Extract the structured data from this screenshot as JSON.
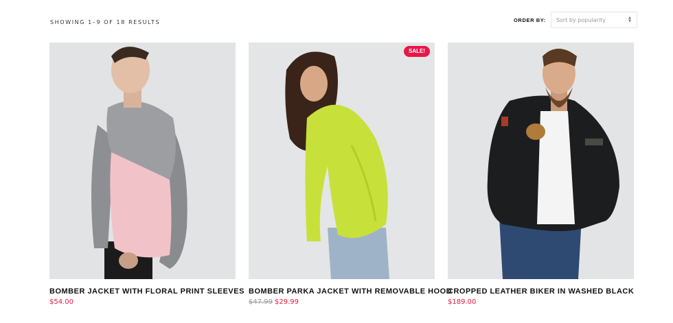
{
  "shop": {
    "result_count": "SHOWING 1–9 OF 18 RESULTS",
    "ordering": {
      "label": "ORDER BY:",
      "selected": "Sort by popularity"
    },
    "colors": {
      "accent": "#e5193c",
      "badge": "#e8174a"
    }
  },
  "products": [
    {
      "title": "BOMBER JACKET WITH FLORAL PRINT SLEEVES",
      "price": "$54.00",
      "image_icon": "model-pink-grey-sweatshirt"
    },
    {
      "title": "BOMBER PARKA JACKET WITH REMOVABLE HOOD",
      "badge": "SALE!",
      "old_price": "$47.99",
      "price": "$29.99",
      "image_icon": "model-lime-knit-sweater"
    },
    {
      "title": "CROPPED LEATHER BIKER IN WASHED BLACK",
      "price": "$189.00",
      "image_icon": "model-black-bomber-jacket"
    }
  ]
}
